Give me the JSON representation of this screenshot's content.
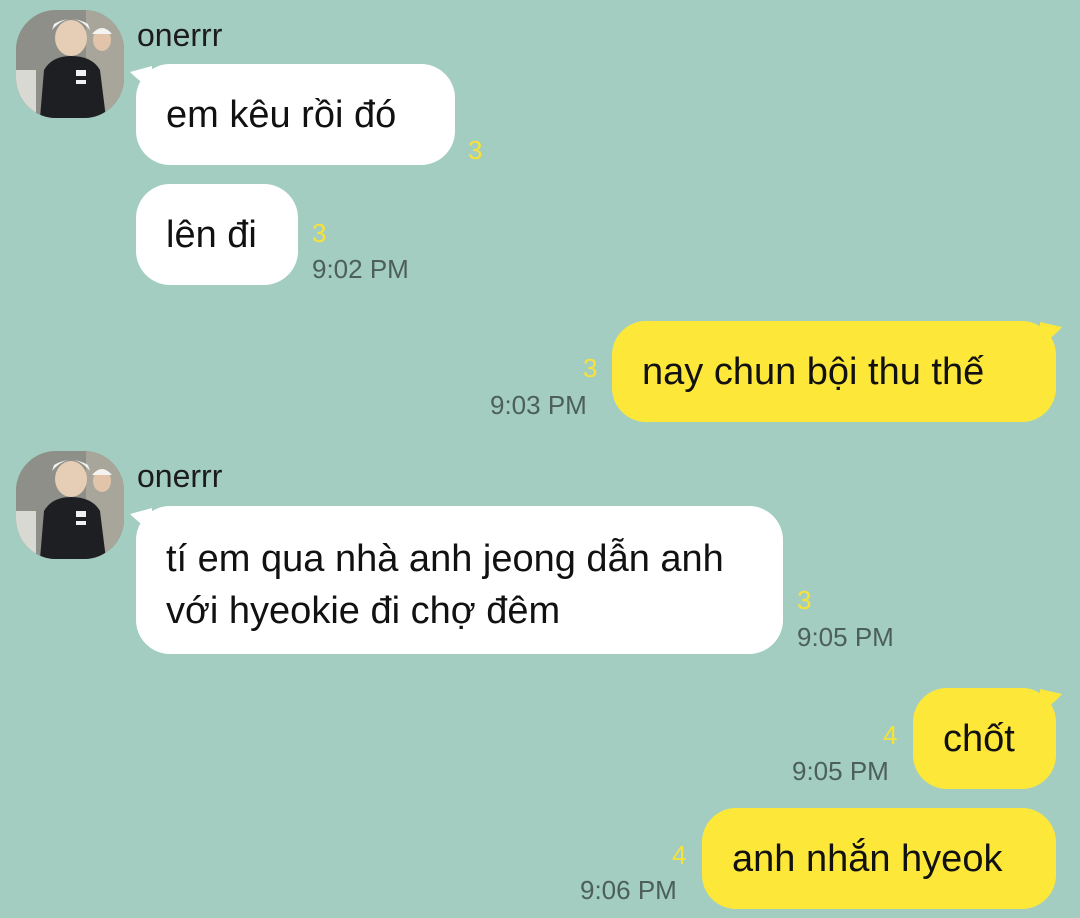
{
  "chat": {
    "messages": [
      {
        "sender": "onerrr",
        "text": "em kêu rồi đó",
        "unread": "3",
        "time": ""
      },
      {
        "sender": "",
        "text": "lên đi",
        "unread": "3",
        "time": "9:02 PM"
      },
      {
        "sender": "me",
        "text": "nay chun bội thu thế",
        "unread": "3",
        "time": "9:03 PM"
      },
      {
        "sender": "onerrr",
        "text": "tí em qua nhà anh jeong dẫn anh với hyeokie đi chợ đêm",
        "unread": "3",
        "time": "9:05 PM"
      },
      {
        "sender": "me",
        "text": "chốt",
        "unread": "4",
        "time": "9:05 PM"
      },
      {
        "sender": "me",
        "text": "anh nhắn hyeok",
        "unread": "4",
        "time": "9:06 PM"
      }
    ]
  },
  "theme": {
    "background": "#a2cdc0",
    "incoming_bubble": "#ffffff",
    "outgoing_bubble": "#fde83a",
    "unread_color": "#f8e23a",
    "time_color": "#4d5f59"
  }
}
